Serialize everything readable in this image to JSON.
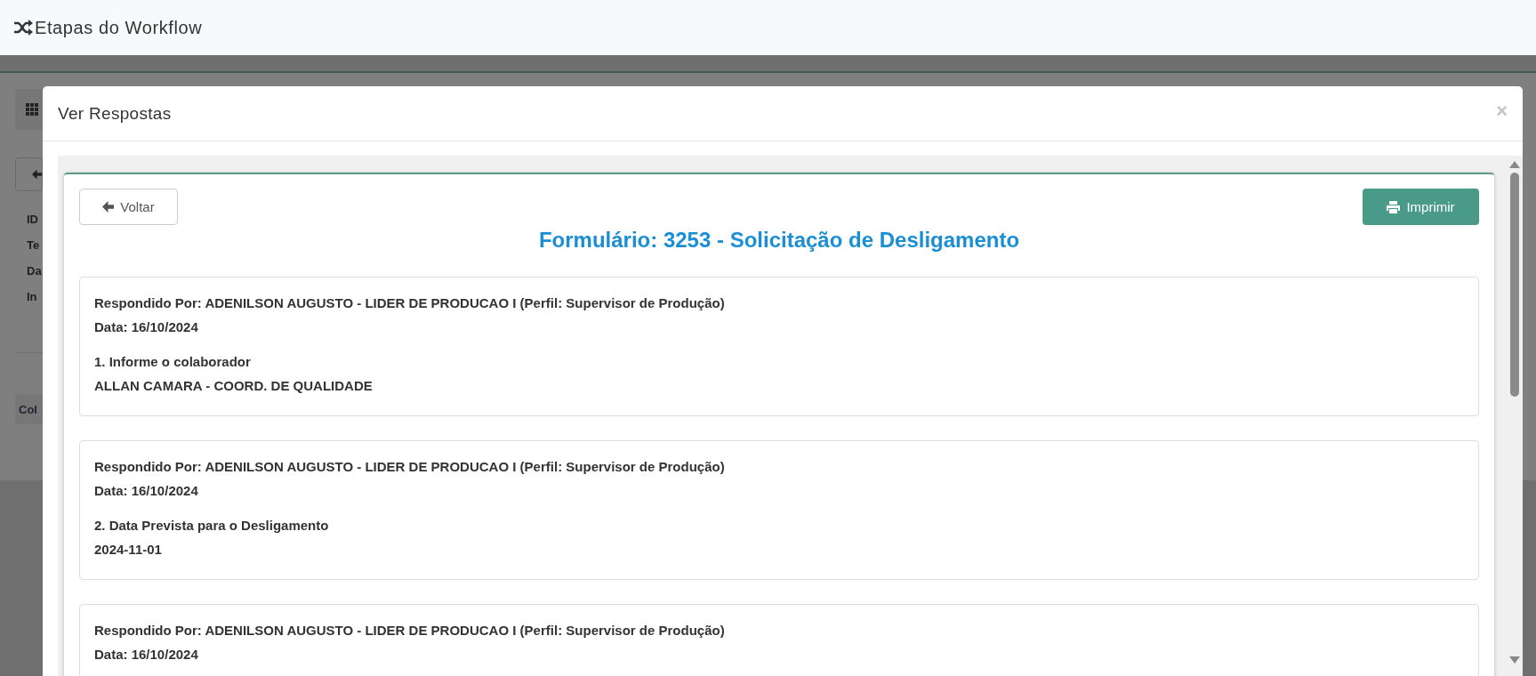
{
  "header": {
    "title": "Etapas do Workflow"
  },
  "background": {
    "labels": [
      "ID",
      "Te",
      "Da",
      "In"
    ],
    "tab": "Col"
  },
  "modal": {
    "title": "Ver Respostas",
    "close": "×",
    "back_button": "Voltar",
    "print_button": "Imprimir",
    "form_title": "Formulário: 3253 - Solicitação de Desligamento",
    "answers": [
      {
        "answered_by": "Respondido Por: ADENILSON AUGUSTO - LIDER DE PRODUCAO I (Perfil: Supervisor de Produção)",
        "date": "Data: 16/10/2024",
        "question": "1. Informe o colaborador",
        "answer": "ALLAN CAMARA - COORD. DE QUALIDADE"
      },
      {
        "answered_by": "Respondido Por: ADENILSON AUGUSTO - LIDER DE PRODUCAO I (Perfil: Supervisor de Produção)",
        "date": "Data: 16/10/2024",
        "question": "2. Data Prevista para o Desligamento",
        "answer": "2024-11-01"
      },
      {
        "answered_by": "Respondido Por: ADENILSON AUGUSTO - LIDER DE PRODUCAO I (Perfil: Supervisor de Produção)",
        "date": "Data: 16/10/2024"
      }
    ]
  }
}
